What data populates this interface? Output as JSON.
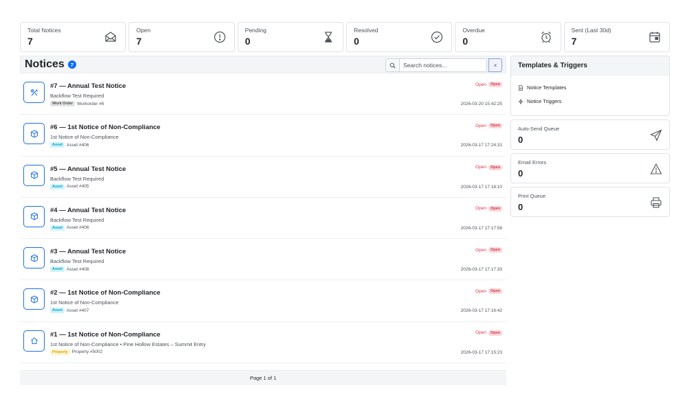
{
  "stats": [
    {
      "label": "Total Notices",
      "value": "7",
      "icon": "envelope-open-icon"
    },
    {
      "label": "Open",
      "value": "7",
      "icon": "exclamation-circle-icon"
    },
    {
      "label": "Pending",
      "value": "0",
      "icon": "hourglass-icon"
    },
    {
      "label": "Resolved",
      "value": "0",
      "icon": "check-circle-icon"
    },
    {
      "label": "Overdue",
      "value": "0",
      "icon": "alarm-clock-icon"
    },
    {
      "label": "Sent (Last 30d)",
      "value": "7",
      "icon": "calendar-icon"
    }
  ],
  "notices": {
    "title": "Notices",
    "count": "7",
    "search_placeholder": "Search notices...",
    "clear_label": "×",
    "items": [
      {
        "title": "#7 — Annual Test Notice",
        "subtitle": "Backflow Test Required",
        "tag": "Work Order",
        "ref": "Workorder #6",
        "status": "Open",
        "badge": "Open",
        "date": "2026-03-20 15:42:25",
        "icon": "tools-icon"
      },
      {
        "title": "#6 — 1st Notice of Non-Compliance",
        "subtitle": "1st Notice of Non-Compliance",
        "tag": "Asset",
        "ref": "Asset #406",
        "status": "Open",
        "badge": "Open",
        "date": "2026-03-17 17:24:31",
        "icon": "box-icon"
      },
      {
        "title": "#5 — Annual Test Notice",
        "subtitle": "Backflow Test Required",
        "tag": "Asset",
        "ref": "Asset #405",
        "status": "Open",
        "badge": "Open",
        "date": "2026-03-17 17:18:10",
        "icon": "box-icon"
      },
      {
        "title": "#4 — Annual Test Notice",
        "subtitle": "Backflow Test Required",
        "tag": "Asset",
        "ref": "Asset #406",
        "status": "Open",
        "badge": "Open",
        "date": "2026-03-17 17:17:58",
        "icon": "box-icon"
      },
      {
        "title": "#3 — Annual Test Notice",
        "subtitle": "Backflow Test Required",
        "tag": "Asset",
        "ref": "Asset #408",
        "status": "Open",
        "badge": "Open",
        "date": "2026-03-17 17:17:33",
        "icon": "box-icon"
      },
      {
        "title": "#2 — 1st Notice of Non-Compliance",
        "subtitle": "1st Notice of Non-Compliance",
        "tag": "Asset",
        "ref": "Asset #407",
        "status": "Open",
        "badge": "Open",
        "date": "2026-03-17 17:16:42",
        "icon": "box-icon"
      },
      {
        "title": "#1 — 1st Notice of Non-Compliance",
        "subtitle": "1st Notice of Non-Compliance • Pine Hollow Estates – Summit Entry",
        "tag": "Property",
        "ref": "Property #5002",
        "status": "Open",
        "badge": "Open",
        "date": "2026-03-17 17:15:23",
        "icon": "house-icon"
      }
    ],
    "pager": "Page 1 of 1"
  },
  "templates": {
    "title": "Templates & Triggers",
    "link_templates": "Notice Templates",
    "link_triggers": "Notice Triggers"
  },
  "side_stats": [
    {
      "label": "Auto-Send Queue",
      "value": "0",
      "icon": "send-icon"
    },
    {
      "label": "Email Errors",
      "value": "0",
      "icon": "warning-icon"
    },
    {
      "label": "Print Queue",
      "value": "0",
      "icon": "printer-icon"
    }
  ],
  "colors": {
    "accent": "#1a6fe8",
    "badge": "#0d6efd",
    "danger": "#dc3545"
  }
}
